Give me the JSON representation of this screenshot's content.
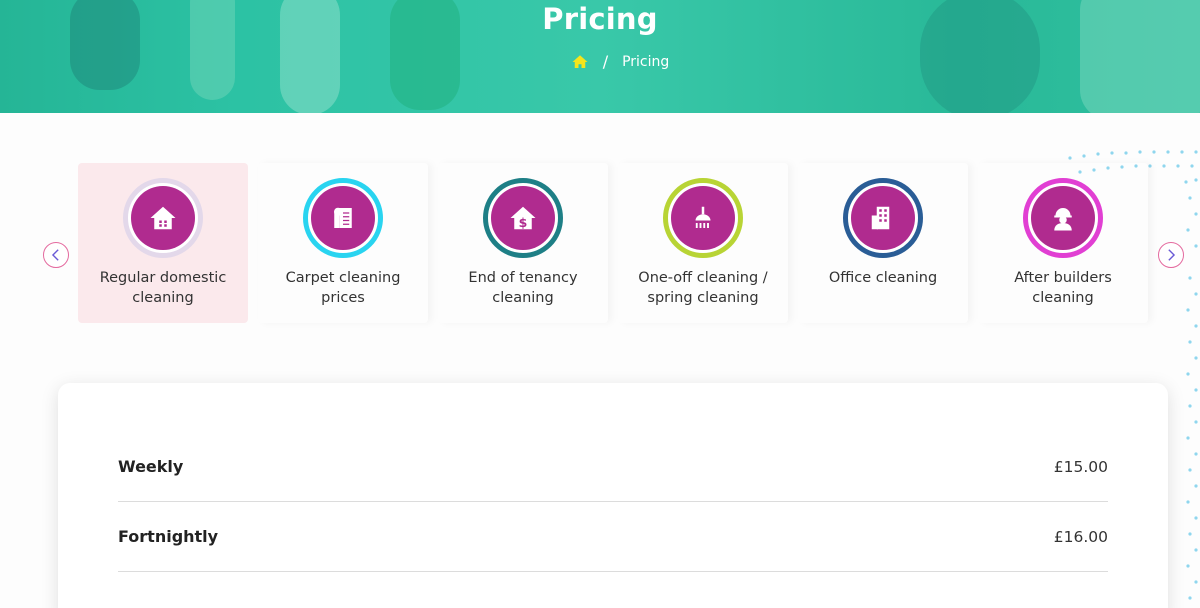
{
  "hero": {
    "title": "Pricing",
    "breadcrumb": {
      "home_icon": "home-icon",
      "separator": "/",
      "current": "Pricing"
    }
  },
  "carousel": {
    "prev_icon": "chevron-left-icon",
    "next_icon": "chevron-right-icon",
    "items": [
      {
        "label": "Regular domestic cleaning",
        "icon": "house-icon",
        "ring": "#e3d8ea",
        "active": true
      },
      {
        "label": "Carpet cleaning prices",
        "icon": "carpet-roll-icon",
        "ring": "#29d4f0",
        "active": false
      },
      {
        "label": "End of tenancy cleaning",
        "icon": "house-dollar-icon",
        "ring": "#1e7f86",
        "active": false
      },
      {
        "label": "One-off cleaning / spring cleaning",
        "icon": "brush-icon",
        "ring": "#b8d435",
        "active": false
      },
      {
        "label": "Office cleaning",
        "icon": "office-building-icon",
        "ring": "#2a5d96",
        "active": false
      },
      {
        "label": "After builders cleaning",
        "icon": "builder-icon",
        "ring": "#e13fd3",
        "active": false
      }
    ]
  },
  "colors": {
    "brand_magenta": "#b02b8f",
    "hero_teal": "#2cc2a4",
    "active_card": "#fbe9ec",
    "breadcrumb_home": "#f5e51c"
  },
  "pricing": {
    "rows": [
      {
        "name": "Weekly",
        "price": "£15.00"
      },
      {
        "name": "Fortnightly",
        "price": "£16.00"
      }
    ]
  }
}
